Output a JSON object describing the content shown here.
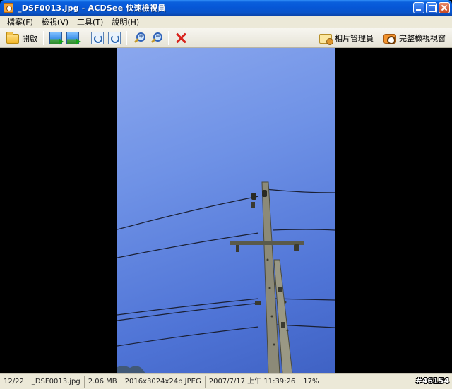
{
  "window": {
    "title": "_DSF0013.jpg - ACDSee 快速檢視員"
  },
  "menu": [
    {
      "label": "檔案(F)"
    },
    {
      "label": "檢視(V)"
    },
    {
      "label": "工具(T)"
    },
    {
      "label": "說明(H)"
    }
  ],
  "toolbar": {
    "open_label": "開啟",
    "photo_manager_label": "相片管理員",
    "full_viewer_label": "完整檢視視窗"
  },
  "status": {
    "position": "12/22",
    "filename": "_DSF0013.jpg",
    "filesize": "2.06 MB",
    "dimensions": "2016x3024x24b JPEG",
    "datetime": "2007/7/17 上午 11:39:26",
    "zoom": "17%"
  },
  "watermark": "#46154",
  "colors": {
    "titlebar": "#0656d6",
    "chrome": "#ece9d8",
    "viewer_bg": "#000000",
    "sky": "#5a7ee0"
  }
}
